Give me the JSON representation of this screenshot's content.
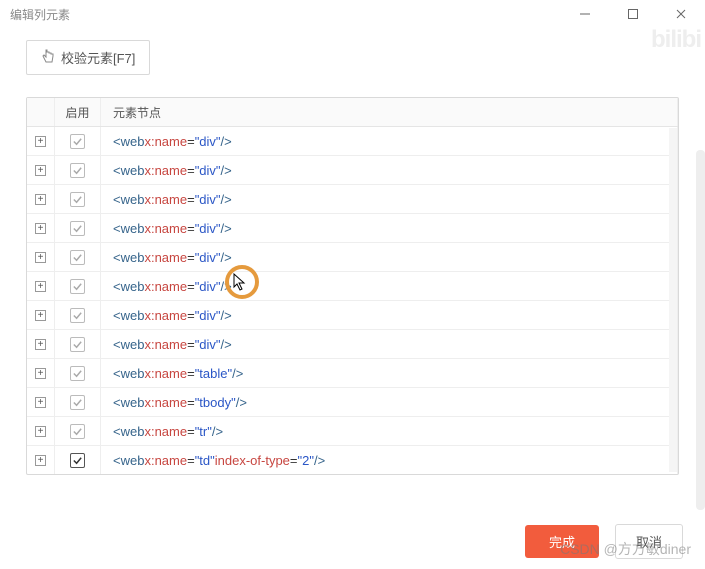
{
  "window": {
    "title": "编辑列元素"
  },
  "toolbar": {
    "validate_label": "校验元素[F7]"
  },
  "table": {
    "headers": {
      "expand": "",
      "enable": "启用",
      "node": "元素节点"
    },
    "rows": [
      {
        "checked": false,
        "parts": [
          {
            "t": "punct",
            "v": "<"
          },
          {
            "t": "tag",
            "v": "web "
          },
          {
            "t": "attr",
            "v": "x:name"
          },
          {
            "t": "eq",
            "v": "="
          },
          {
            "t": "val",
            "v": "\"div\""
          },
          {
            "t": "punct",
            "v": " />"
          }
        ]
      },
      {
        "checked": false,
        "parts": [
          {
            "t": "punct",
            "v": "<"
          },
          {
            "t": "tag",
            "v": "web "
          },
          {
            "t": "attr",
            "v": "x:name"
          },
          {
            "t": "eq",
            "v": "="
          },
          {
            "t": "val",
            "v": "\"div\""
          },
          {
            "t": "punct",
            "v": " />"
          }
        ]
      },
      {
        "checked": false,
        "parts": [
          {
            "t": "punct",
            "v": "<"
          },
          {
            "t": "tag",
            "v": "web "
          },
          {
            "t": "attr",
            "v": "x:name"
          },
          {
            "t": "eq",
            "v": "="
          },
          {
            "t": "val",
            "v": "\"div\""
          },
          {
            "t": "punct",
            "v": " />"
          }
        ]
      },
      {
        "checked": false,
        "parts": [
          {
            "t": "punct",
            "v": "<"
          },
          {
            "t": "tag",
            "v": "web "
          },
          {
            "t": "attr",
            "v": "x:name"
          },
          {
            "t": "eq",
            "v": "="
          },
          {
            "t": "val",
            "v": "\"div\""
          },
          {
            "t": "punct",
            "v": " />"
          }
        ]
      },
      {
        "checked": false,
        "parts": [
          {
            "t": "punct",
            "v": "<"
          },
          {
            "t": "tag",
            "v": "web "
          },
          {
            "t": "attr",
            "v": "x:name"
          },
          {
            "t": "eq",
            "v": "="
          },
          {
            "t": "val",
            "v": "\"div\""
          },
          {
            "t": "punct",
            "v": " />"
          }
        ]
      },
      {
        "checked": false,
        "parts": [
          {
            "t": "punct",
            "v": "<"
          },
          {
            "t": "tag",
            "v": "web "
          },
          {
            "t": "attr",
            "v": "x:name"
          },
          {
            "t": "eq",
            "v": "="
          },
          {
            "t": "val",
            "v": "\"div\""
          },
          {
            "t": "punct",
            "v": " />"
          }
        ]
      },
      {
        "checked": false,
        "parts": [
          {
            "t": "punct",
            "v": "<"
          },
          {
            "t": "tag",
            "v": "web "
          },
          {
            "t": "attr",
            "v": "x:name"
          },
          {
            "t": "eq",
            "v": "="
          },
          {
            "t": "val",
            "v": "\"div\""
          },
          {
            "t": "punct",
            "v": " />"
          }
        ]
      },
      {
        "checked": false,
        "parts": [
          {
            "t": "punct",
            "v": "<"
          },
          {
            "t": "tag",
            "v": "web "
          },
          {
            "t": "attr",
            "v": "x:name"
          },
          {
            "t": "eq",
            "v": "="
          },
          {
            "t": "val",
            "v": "\"div\""
          },
          {
            "t": "punct",
            "v": " />"
          }
        ]
      },
      {
        "checked": false,
        "parts": [
          {
            "t": "punct",
            "v": "<"
          },
          {
            "t": "tag",
            "v": "web "
          },
          {
            "t": "attr",
            "v": "x:name"
          },
          {
            "t": "eq",
            "v": "="
          },
          {
            "t": "val",
            "v": "\"table\""
          },
          {
            "t": "punct",
            "v": " />"
          }
        ]
      },
      {
        "checked": false,
        "parts": [
          {
            "t": "punct",
            "v": "<"
          },
          {
            "t": "tag",
            "v": "web "
          },
          {
            "t": "attr",
            "v": "x:name"
          },
          {
            "t": "eq",
            "v": "="
          },
          {
            "t": "val",
            "v": "\"tbody\""
          },
          {
            "t": "punct",
            "v": " />"
          }
        ]
      },
      {
        "checked": false,
        "parts": [
          {
            "t": "punct",
            "v": "<"
          },
          {
            "t": "tag",
            "v": "web "
          },
          {
            "t": "attr",
            "v": "x:name"
          },
          {
            "t": "eq",
            "v": "="
          },
          {
            "t": "val",
            "v": "\"tr\""
          },
          {
            "t": "punct",
            "v": " />"
          }
        ]
      },
      {
        "checked": true,
        "parts": [
          {
            "t": "punct",
            "v": "<"
          },
          {
            "t": "tag",
            "v": "web "
          },
          {
            "t": "attr",
            "v": "x:name"
          },
          {
            "t": "eq",
            "v": "="
          },
          {
            "t": "val",
            "v": "\"td\""
          },
          {
            "t": "tag",
            "v": " "
          },
          {
            "t": "attr",
            "v": "index-of-type"
          },
          {
            "t": "eq",
            "v": "="
          },
          {
            "t": "val",
            "v": "\"2\""
          },
          {
            "t": "punct",
            "v": " />"
          }
        ]
      }
    ]
  },
  "footer": {
    "ok_label": "完成",
    "cancel_label": "取消"
  },
  "watermarks": {
    "top": "bilibi",
    "bottom": "CSDN @方方敏diner"
  }
}
